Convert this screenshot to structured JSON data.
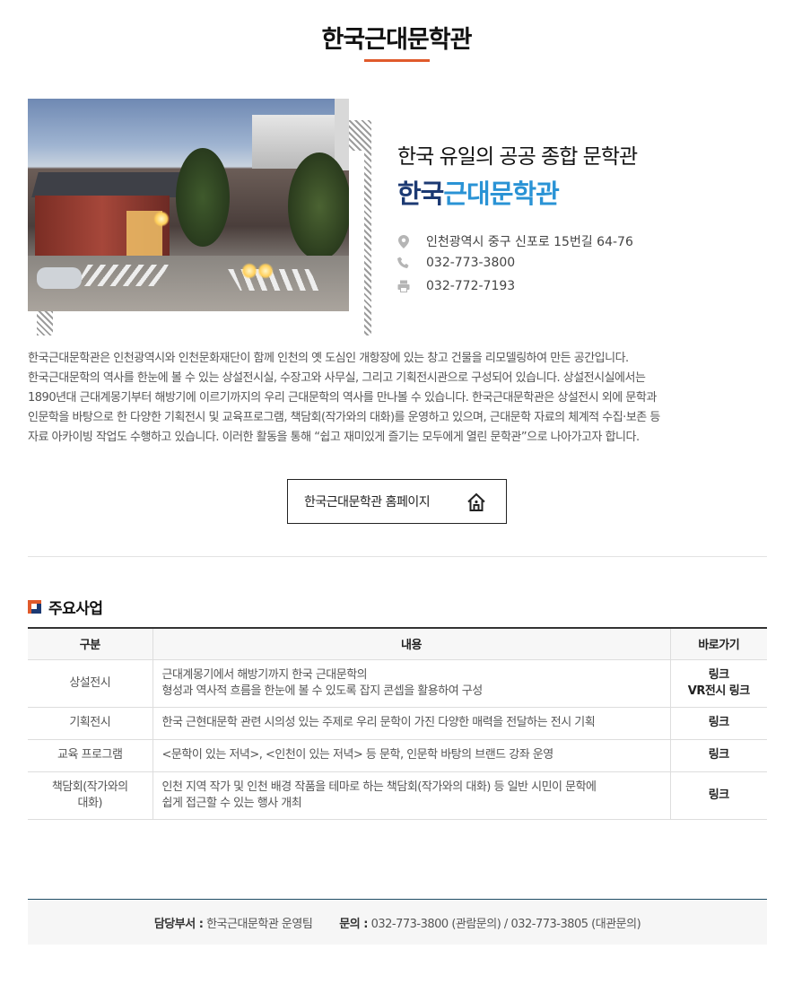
{
  "page": {
    "title": "한국근대문학관"
  },
  "intro": {
    "subtitle": "한국 유일의 공공 종합 문학관",
    "name_part1": "한국",
    "name_part2": "근대문학관",
    "address": "인천광역시 중구 신포로 15번길 64-76",
    "tel": "032-773-3800",
    "fax": "032-772-7193"
  },
  "description": [
    "한국근대문학관은 인천광역시와 인천문화재단이 함께 인천의 옛 도심인 개항장에 있는 창고 건물을 리모델링하여 만든 공간입니다.",
    "한국근대문학의 역사를 한눈에 볼 수 있는 상설전시실, 수장고와 사무실, 그리고 기획전시관으로 구성되어 있습니다. 상설전시실에서는",
    "1890년대 근대계몽기부터 해방기에 이르기까지의 우리 근대문학의 역사를 만나볼 수 있습니다. 한국근대문학관은 상설전시 외에 문학과",
    "인문학을 바탕으로 한 다양한 기획전시 및 교육프로그램, 책담회(작가와의 대화)를 운영하고 있으며, 근대문학 자료의 체계적 수집·보존 등",
    "자료 아카이빙 작업도 수행하고 있습니다. 이러한 활동을 통해 “쉽고 재미있게 즐기는 모두에게 열린 문학관”으로 나아가고자 합니다."
  ],
  "home_button": {
    "label": "한국근대문학관 홈페이지"
  },
  "section": {
    "title": "주요사업",
    "icon_colors": {
      "orange": "#e05a2b",
      "navy": "#1c3a73"
    }
  },
  "table": {
    "headers": [
      "구분",
      "내용",
      "바로가기"
    ],
    "rows": [
      {
        "category": "상설전시",
        "content": [
          "근대계몽기에서 해방기까지 한국 근대문학의",
          "형성과 역사적 흐름을 한눈에 볼 수 있도록 잡지 콘셉을 활용하여 구성"
        ],
        "links": [
          "링크",
          "VR전시 링크"
        ]
      },
      {
        "category": "기획전시",
        "content": [
          "한국 근현대문학 관련 시의성 있는 주제로 우리 문학이 가진 다양한 매력을 전달하는 전시 기획"
        ],
        "links": [
          "링크"
        ]
      },
      {
        "category": "교육 프로그램",
        "content": [
          "<문학이 있는 저녁>, <인천이 있는 저녁> 등 문학, 인문학 바탕의 브랜드 강좌 운영"
        ],
        "links": [
          "링크"
        ]
      },
      {
        "category_lines": [
          "책담회(작가와의",
          "대화)"
        ],
        "content": [
          "인천 지역 작가 및 인천 배경 작품을 테마로 하는 책담회(작가와의 대화) 등 일반 시민이 문학에",
          "쉽게 접근할 수 있는 행사 개최"
        ],
        "links": [
          "링크"
        ]
      }
    ]
  },
  "footer": {
    "dept_label": "담당부서 :",
    "dept_value": "한국근대문학관 운영팀",
    "inquiry_label": "문의 :",
    "inquiry_value": "032-773-3800 (관람문의) / 032-773-3805 (대관문의)"
  },
  "colors": {
    "accent_orange": "#e05a2b",
    "brand_navy": "#1c3a73",
    "brand_blue": "#2a93d5",
    "footer_line": "#1f4d66"
  }
}
